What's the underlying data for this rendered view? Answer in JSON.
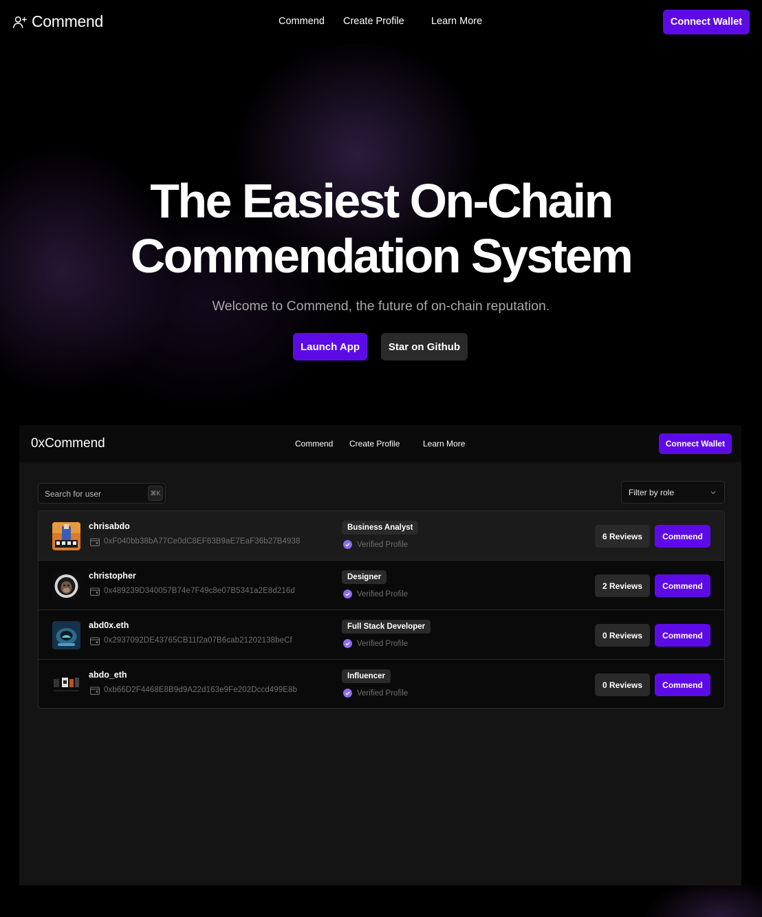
{
  "nav": {
    "brand": "Commend",
    "links": [
      "Commend",
      "Create Profile",
      "Learn More"
    ],
    "connect_wallet": "Connect Wallet"
  },
  "hero": {
    "title_line1": "The Easiest On-Chain",
    "title_line2": "Commendation System",
    "subtitle": "Welcome to Commend, the future of on-chain reputation.",
    "launch_button": "Launch App",
    "github_button": "Star on Github"
  },
  "preview": {
    "brand": "0xCommend",
    "links": [
      "Commend",
      "Create Profile",
      "Learn More"
    ],
    "connect_wallet": "Connect Wallet",
    "search": {
      "placeholder": "Search for user",
      "shortcut": "⌘K"
    },
    "filter": {
      "label": "Filter by role"
    },
    "users": [
      {
        "name": "chrisabdo",
        "address": "0xF040bb38bA77Ce0dC8EF63B9aE7EaF36b27B4938",
        "role": "Business Analyst",
        "verified": "Verified Profile",
        "reviews": "6 Reviews",
        "action": "Commend"
      },
      {
        "name": "christopher",
        "address": "0x489239D340057B74e7F49c8e07B5341a2E8d216d",
        "role": "Designer",
        "verified": "Verified Profile",
        "reviews": "2 Reviews",
        "action": "Commend"
      },
      {
        "name": "abd0x.eth",
        "address": "0x2937092DE43765CB11f2a07B6cab21202138beCf",
        "role": "Full Stack Developer",
        "verified": "Verified Profile",
        "reviews": "0 Reviews",
        "action": "Commend"
      },
      {
        "name": "abdo_eth",
        "address": "0xb66D2F4468E8B9d9A22d163e9Fe202Dccd499E8b",
        "role": "Influencer",
        "verified": "Verified Profile",
        "reviews": "0 Reviews",
        "action": "Commend"
      }
    ]
  },
  "colors": {
    "accent": "#5d0be6",
    "verified": "#8b6cf0",
    "background": "#000000"
  },
  "icons": {
    "brand": "user-plus-icon",
    "wallet": "wallet-icon",
    "verified": "check-circle-icon",
    "filter": "chevron-down-icon"
  }
}
